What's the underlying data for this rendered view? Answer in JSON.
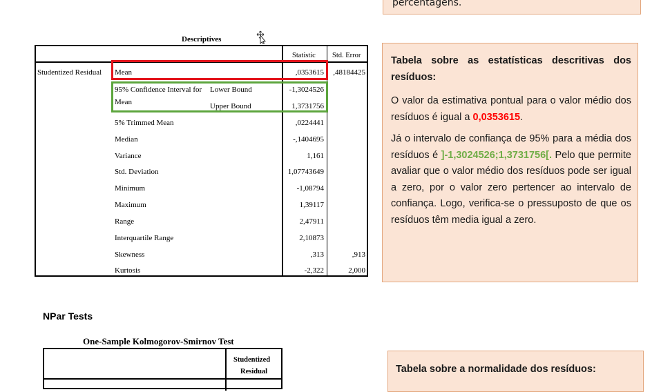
{
  "top_note": {
    "text": "percentagens."
  },
  "descriptives": {
    "title": "Descriptives",
    "col_statistic": "Statistic",
    "col_std_error": "Std. Error",
    "row_group": "Studentized Residual",
    "rows": [
      {
        "label": "Mean",
        "sub": "",
        "statistic": ",0353615",
        "std_error": ",48184425"
      },
      {
        "label": "95% Confidence Interval for",
        "sub": "Lower Bound",
        "statistic": "-1,3024526",
        "std_error": ""
      },
      {
        "label": "Mean",
        "sub": "Upper Bound",
        "statistic": "1,3731756",
        "std_error": ""
      },
      {
        "label": "5% Trimmed Mean",
        "sub": "",
        "statistic": ",0224441",
        "std_error": ""
      },
      {
        "label": "Median",
        "sub": "",
        "statistic": "-,1404695",
        "std_error": ""
      },
      {
        "label": "Variance",
        "sub": "",
        "statistic": "1,161",
        "std_error": ""
      },
      {
        "label": "Std. Deviation",
        "sub": "",
        "statistic": "1,07743649",
        "std_error": ""
      },
      {
        "label": "Minimum",
        "sub": "",
        "statistic": "-1,08794",
        "std_error": ""
      },
      {
        "label": "Maximum",
        "sub": "",
        "statistic": "1,39117",
        "std_error": ""
      },
      {
        "label": "Range",
        "sub": "",
        "statistic": "2,47911",
        "std_error": ""
      },
      {
        "label": "Interquartile Range",
        "sub": "",
        "statistic": "2,10873",
        "std_error": ""
      },
      {
        "label": "Skewness",
        "sub": "",
        "statistic": ",313",
        "std_error": ",913"
      },
      {
        "label": "Kurtosis",
        "sub": "",
        "statistic": "-2,322",
        "std_error": "2,000"
      }
    ]
  },
  "commentary": {
    "heading": "Tabela sobre as estatísticas descritivas dos resíduos:",
    "p1_before": "O valor da estimativa pontual para o valor médio dos resíduos é igual a ",
    "p1_value": "0,0353615",
    "p1_after": ".",
    "p2_before": "Já o intervalo de confiança de 95% para a média dos resíduos é ",
    "p2_value": "]-1,3024526;1,3731756[.",
    "p2_after": " Pelo que permite avaliar que o valor médio dos resíduos pode ser igual a zero, por o valor zero pertencer ao intervalo de confiança. Logo, verifica-se o pressuposto de que os resíduos têm media igual a zero.",
    "colors": {
      "highlight_red": "#ff0000",
      "highlight_green": "#70ad47",
      "box_fill": "#fbe4d5",
      "box_border": "#e3a77e"
    }
  },
  "npar": {
    "heading": "NPar Tests",
    "ks_title": "One-Sample Kolmogorov-Smirnov Test",
    "col_header_line1": "Studentized",
    "col_header_line2": "Residual"
  },
  "bottom_note": {
    "heading": "Tabela sobre a normalidade dos resíduos:"
  },
  "icons": {
    "cursor": "move-cursor-icon"
  }
}
